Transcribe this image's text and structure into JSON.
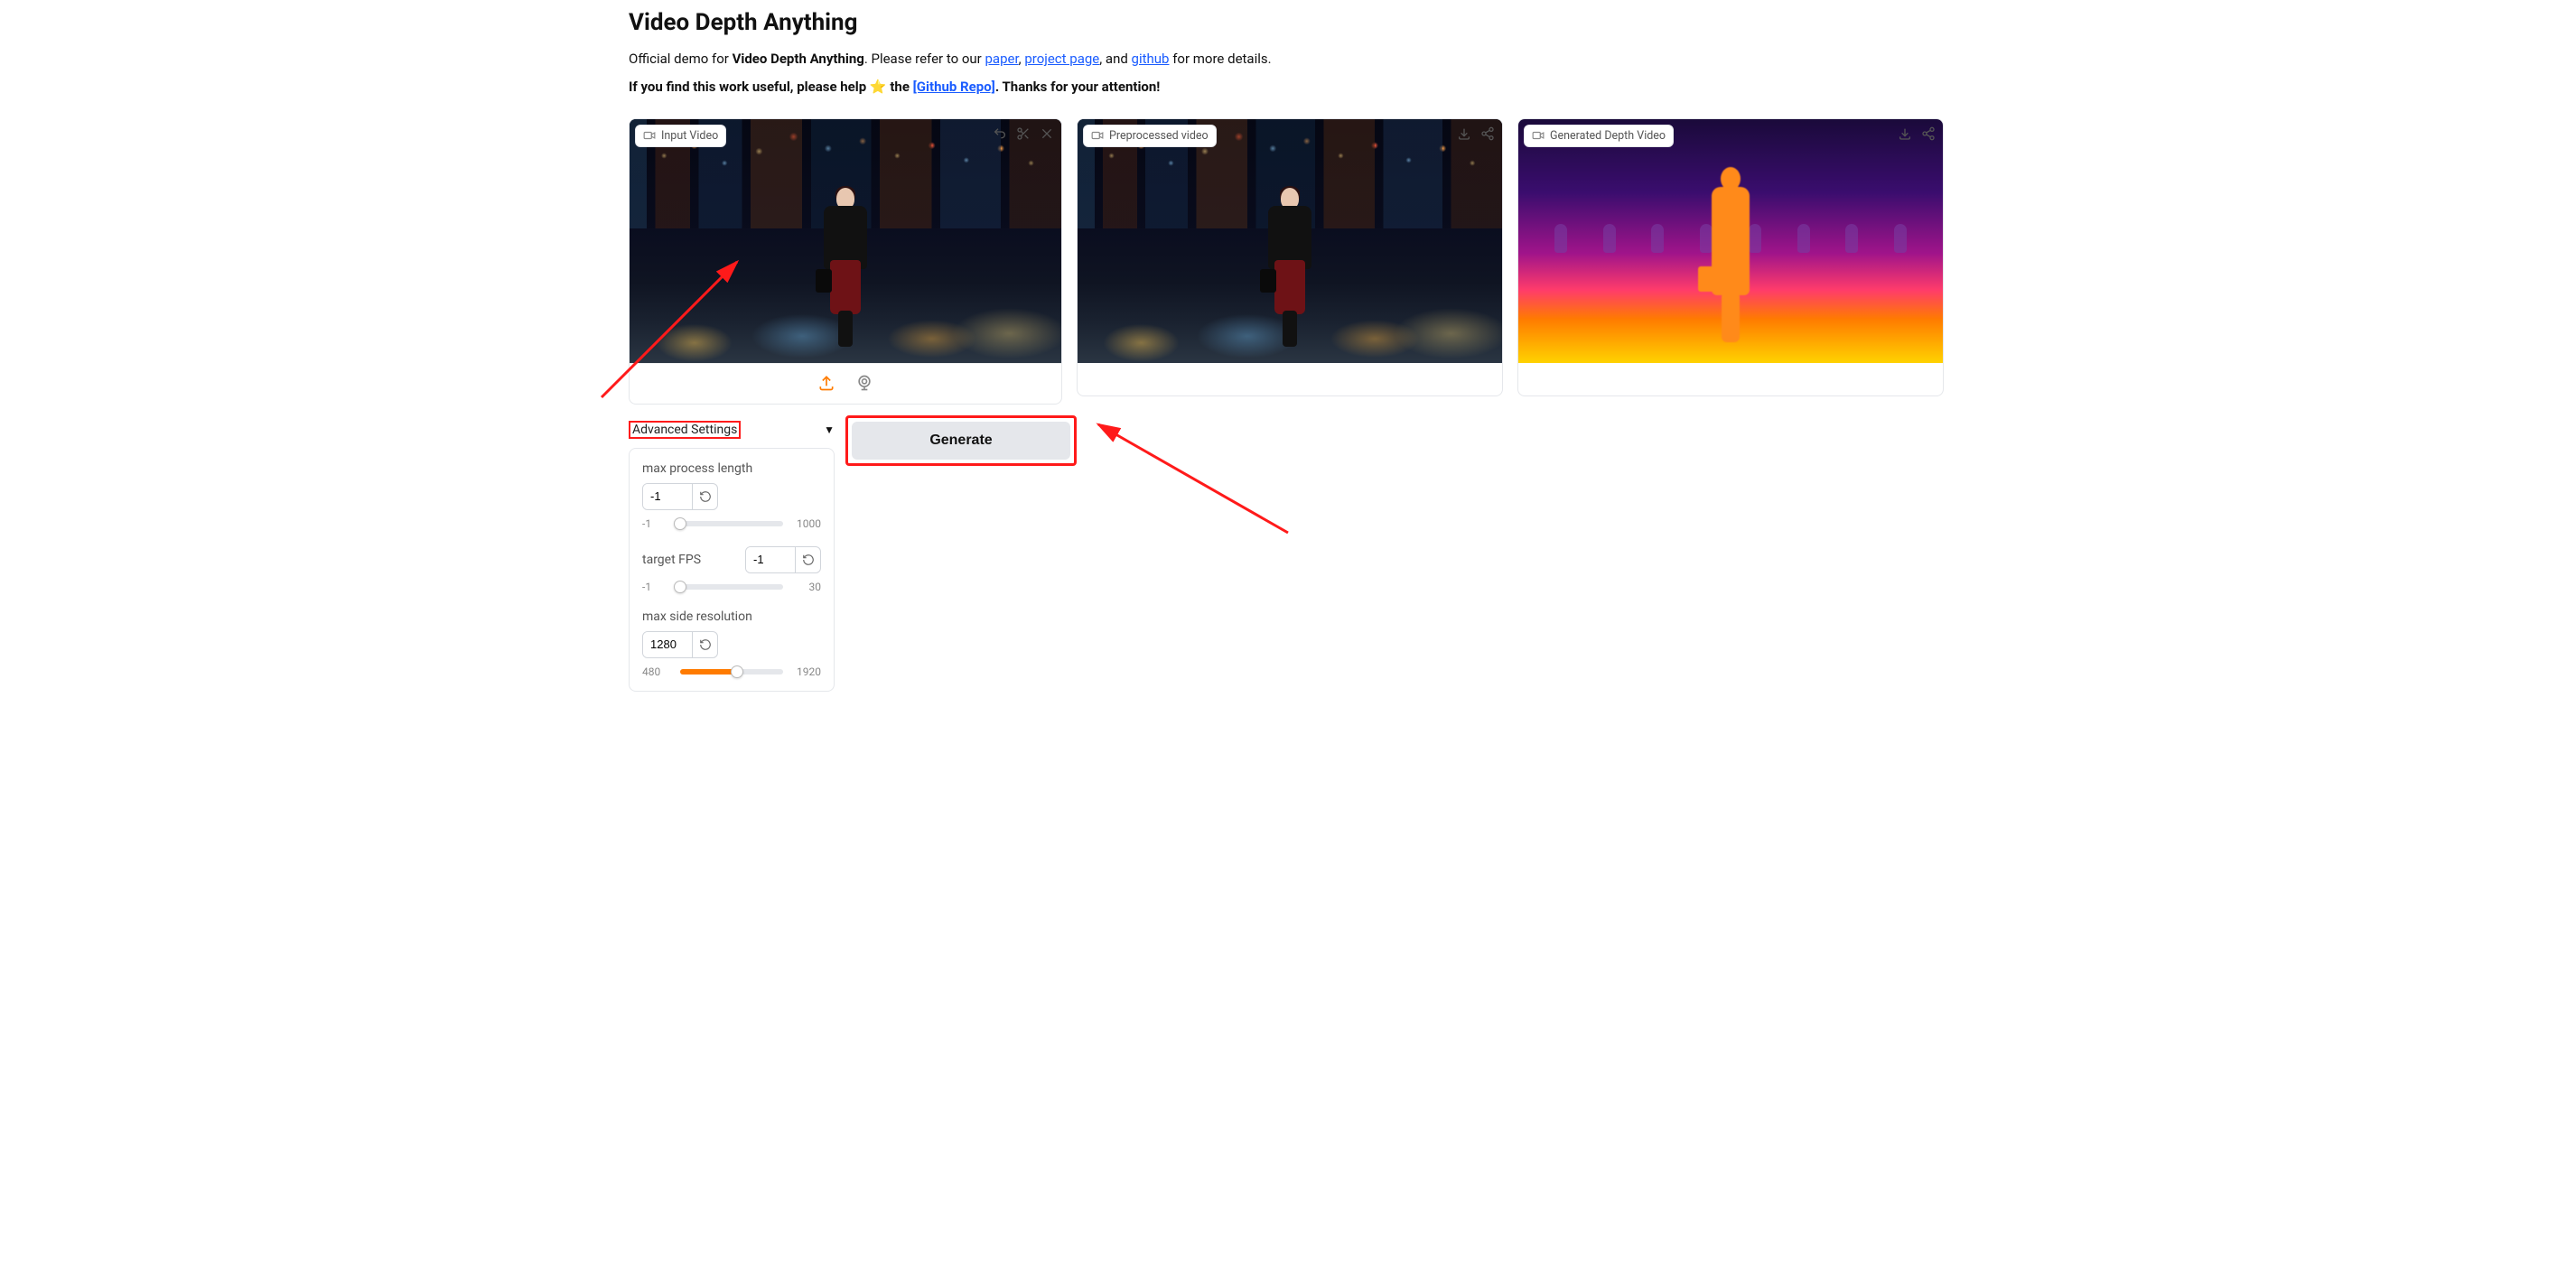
{
  "header": {
    "title": "Video Depth Anything",
    "intro_prefix": "Official demo for ",
    "intro_bold": "Video Depth Anything",
    "intro_mid1": ". Please refer to our ",
    "link_paper": "paper",
    "intro_mid2": ", ",
    "link_project": "project page",
    "intro_mid3": ", and ",
    "link_github": "github",
    "intro_suffix": " for more details.",
    "cta_prefix": "If you find this work useful, please help ",
    "star": "⭐",
    "cta_mid": " the ",
    "link_repo": "[Github Repo]",
    "cta_suffix": ". Thanks for your attention!"
  },
  "videos": {
    "input": {
      "label": "Input Video"
    },
    "pre": {
      "label": "Preprocessed video"
    },
    "depth": {
      "label": "Generated Depth Video"
    }
  },
  "advanced": {
    "title": "Advanced Settings",
    "caret": "▼",
    "max_process_length": {
      "label": "max process length",
      "value": "-1",
      "min": "-1",
      "max": "1000"
    },
    "target_fps": {
      "label": "target FPS",
      "value": "-1",
      "min": "-1",
      "max": "30"
    },
    "max_side_resolution": {
      "label": "max side resolution",
      "value": "1280",
      "min": "480",
      "max": "1920"
    }
  },
  "actions": {
    "generate": "Generate"
  },
  "sliders": {
    "mpl_pct": 0,
    "fps_pct": 0,
    "res_pct": 55
  }
}
